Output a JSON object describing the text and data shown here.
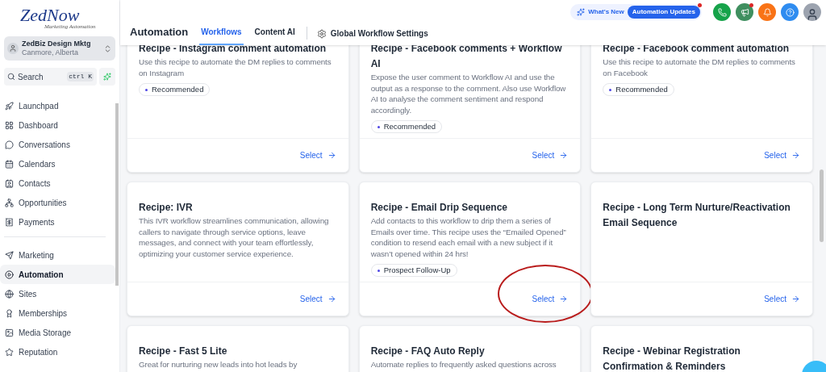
{
  "logo": {
    "brand": "ZedNow",
    "tagline": "Marketing Automation"
  },
  "account": {
    "name": "ZedBiz Design Mktg",
    "location": "Canmore, Alberta"
  },
  "search": {
    "placeholder": "Search",
    "shortcut": "ctrl K"
  },
  "nav_groups": [
    [
      {
        "label": "Launchpad",
        "selected": false
      },
      {
        "label": "Dashboard",
        "selected": false
      },
      {
        "label": "Conversations",
        "selected": false
      },
      {
        "label": "Calendars",
        "selected": false
      },
      {
        "label": "Contacts",
        "selected": false
      },
      {
        "label": "Opportunities",
        "selected": false
      },
      {
        "label": "Payments",
        "selected": false
      }
    ],
    [
      {
        "label": "Marketing",
        "selected": false
      },
      {
        "label": "Automation",
        "selected": true
      },
      {
        "label": "Sites",
        "selected": false
      },
      {
        "label": "Memberships",
        "selected": false
      },
      {
        "label": "Media Storage",
        "selected": false
      },
      {
        "label": "Reputation",
        "selected": false
      }
    ]
  ],
  "top_bar": {
    "whats_new": "What's New",
    "updates": "Automation Updates",
    "updates_dot": true,
    "actions": [
      {
        "color": "#16a34a",
        "dot": false
      },
      {
        "color": "#3f8f5f",
        "dot": true
      },
      {
        "color": "#f97316",
        "dot": false
      },
      {
        "color": "#2f8cf0",
        "dot": false
      }
    ]
  },
  "header": {
    "title": "Automation",
    "tabs": [
      {
        "label": "Workflows",
        "selected": true
      },
      {
        "label": "Content AI",
        "selected": false
      }
    ],
    "settings": "Global Workflow Settings"
  },
  "cards": [
    {
      "title": "Recipe - Instagram comment automation",
      "description": "Use this recipe to automate the DM replies to comments on Instagram",
      "tag": "Recommended",
      "action": "Select"
    },
    {
      "title": "Recipe - Facebook comments + Workflow AI",
      "description": "Expose the user comment to Workflow AI and use the output as a response to the comment. Also use Workflow AI to analyse the comment sentiment and respond accordingly.",
      "tag": "Recommended",
      "action": "Select"
    },
    {
      "title": "Recipe - Facebook comment automation",
      "description": "Use this recipe to automate the DM replies to comments on Facebook",
      "tag": "Recommended",
      "action": "Select"
    },
    {
      "title": "Recipe: IVR",
      "description": "This IVR workflow streamlines communication, allowing callers to navigate through service options, leave messages, and connect with your team effortlessly, optimizing your customer service experience.",
      "action": "Select"
    },
    {
      "title": "Recipe - Email Drip Sequence",
      "description": "Add contacts to this workflow to drip them a series of Emails over time. This recipe uses the “Emailed Opened” condition to resend each email with a new subject if it wasn’t opened within 24 hrs!",
      "tag": "Prospect Follow-Up",
      "action": "Select",
      "circled": true
    },
    {
      "title": "Recipe - Long Term Nurture/Reactivation Email Sequence",
      "action": "Select"
    },
    {
      "title": "Recipe - Fast 5 Lite",
      "description": "Great for nurturing new leads into hot leads by"
    },
    {
      "title": "Recipe - FAQ Auto Reply",
      "description": "Automate replies to frequently asked questions across"
    },
    {
      "title": "Recipe - Webinar Registration Confirmation & Reminders"
    }
  ]
}
